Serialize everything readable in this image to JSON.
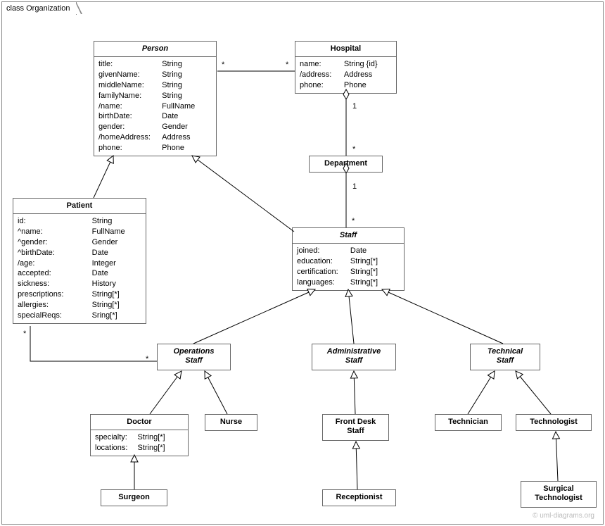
{
  "frame": {
    "title": "class Organization"
  },
  "watermark": "© uml-diagrams.org",
  "classes": {
    "person": {
      "title": "Person",
      "attrs": [
        [
          "title:",
          "String"
        ],
        [
          "givenName:",
          "String"
        ],
        [
          "middleName:",
          "String"
        ],
        [
          "familyName:",
          "String"
        ],
        [
          "/name:",
          "FullName"
        ],
        [
          "birthDate:",
          "Date"
        ],
        [
          "gender:",
          "Gender"
        ],
        [
          "/homeAddress:",
          "Address"
        ],
        [
          "phone:",
          "Phone"
        ]
      ]
    },
    "hospital": {
      "title": "Hospital",
      "attrs": [
        [
          "name:",
          "String {id}"
        ],
        [
          "/address:",
          "Address"
        ],
        [
          "phone:",
          "Phone"
        ]
      ]
    },
    "department": {
      "title": "Department"
    },
    "patient": {
      "title": "Patient",
      "attrs": [
        [
          "id:",
          "String"
        ],
        [
          "^name:",
          "FullName"
        ],
        [
          "^gender:",
          "Gender"
        ],
        [
          "^birthDate:",
          "Date"
        ],
        [
          "/age:",
          "Integer"
        ],
        [
          "accepted:",
          "Date"
        ],
        [
          "sickness:",
          "History"
        ],
        [
          "prescriptions:",
          "String[*]"
        ],
        [
          "allergies:",
          "String[*]"
        ],
        [
          "specialReqs:",
          "Sring[*]"
        ]
      ]
    },
    "staff": {
      "title": "Staff",
      "attrs": [
        [
          "joined:",
          "Date"
        ],
        [
          "education:",
          "String[*]"
        ],
        [
          "certification:",
          "String[*]"
        ],
        [
          "languages:",
          "String[*]"
        ]
      ]
    },
    "opsStaff": {
      "title": "Operations\nStaff"
    },
    "adminStaff": {
      "title": "Administrative\nStaff"
    },
    "techStaff": {
      "title": "Technical\nStaff"
    },
    "doctor": {
      "title": "Doctor",
      "attrs": [
        [
          "specialty:",
          "String[*]"
        ],
        [
          "locations:",
          "String[*]"
        ]
      ]
    },
    "nurse": {
      "title": "Nurse"
    },
    "frontDesk": {
      "title": "Front Desk\nStaff"
    },
    "technician": {
      "title": "Technician"
    },
    "technologist": {
      "title": "Technologist"
    },
    "surgeon": {
      "title": "Surgeon"
    },
    "receptionist": {
      "title": "Receptionist"
    },
    "surgTech": {
      "title": "Surgical\nTechnologist"
    }
  },
  "mult": {
    "person_hosp_left": "*",
    "person_hosp_right": "*",
    "hosp_dept_top": "1",
    "hosp_dept_bottom": "*",
    "dept_staff_top": "1",
    "dept_staff_bottom": "*",
    "patient_ops_left": "*",
    "patient_ops_right": "*"
  }
}
